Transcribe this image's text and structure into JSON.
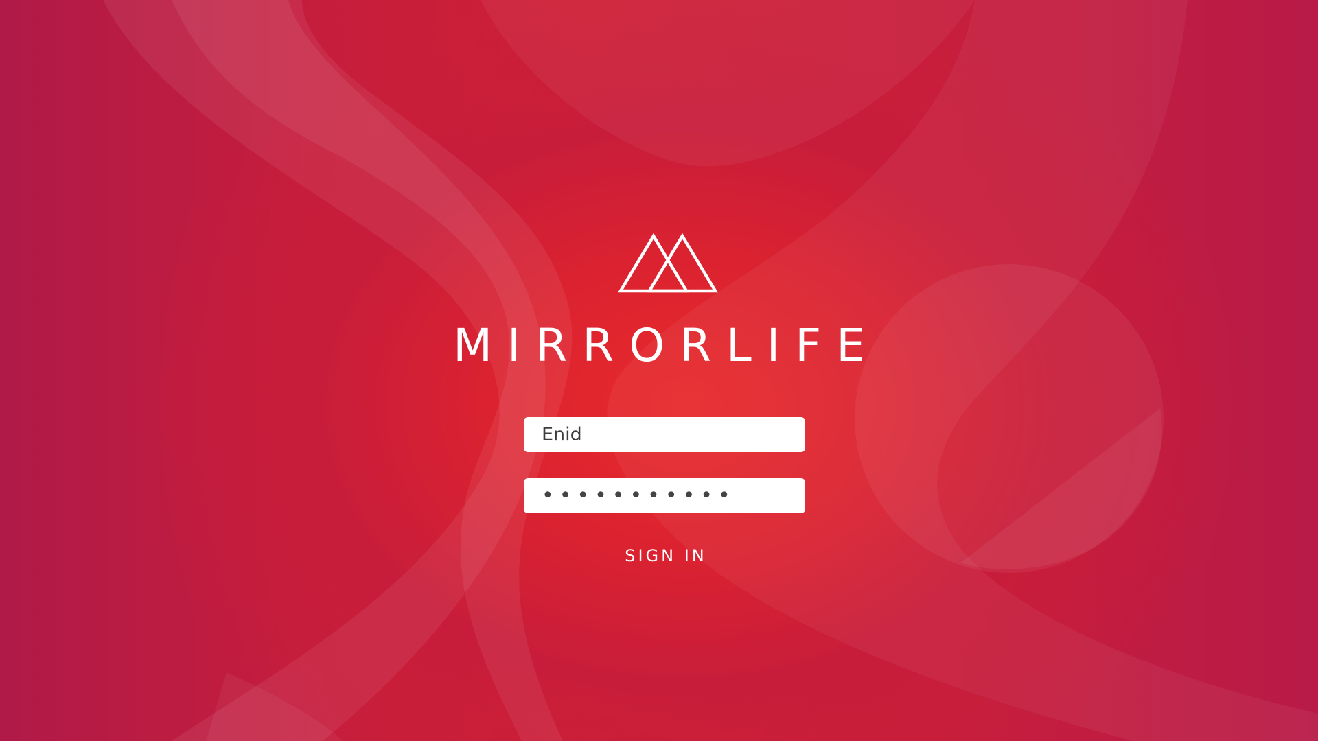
{
  "brand": {
    "name": "MIRRORLIFE",
    "logo_icon": "mountain-peaks-icon"
  },
  "login": {
    "username_value": "Enid",
    "password_value": "•••••••••••",
    "signin_label": "SIGN IN"
  },
  "colors": {
    "background": "#c41d3d",
    "accent_center": "#e82a2c",
    "text": "#ffffff",
    "field_background": "#ffffff",
    "field_text": "#3c3c3c"
  }
}
